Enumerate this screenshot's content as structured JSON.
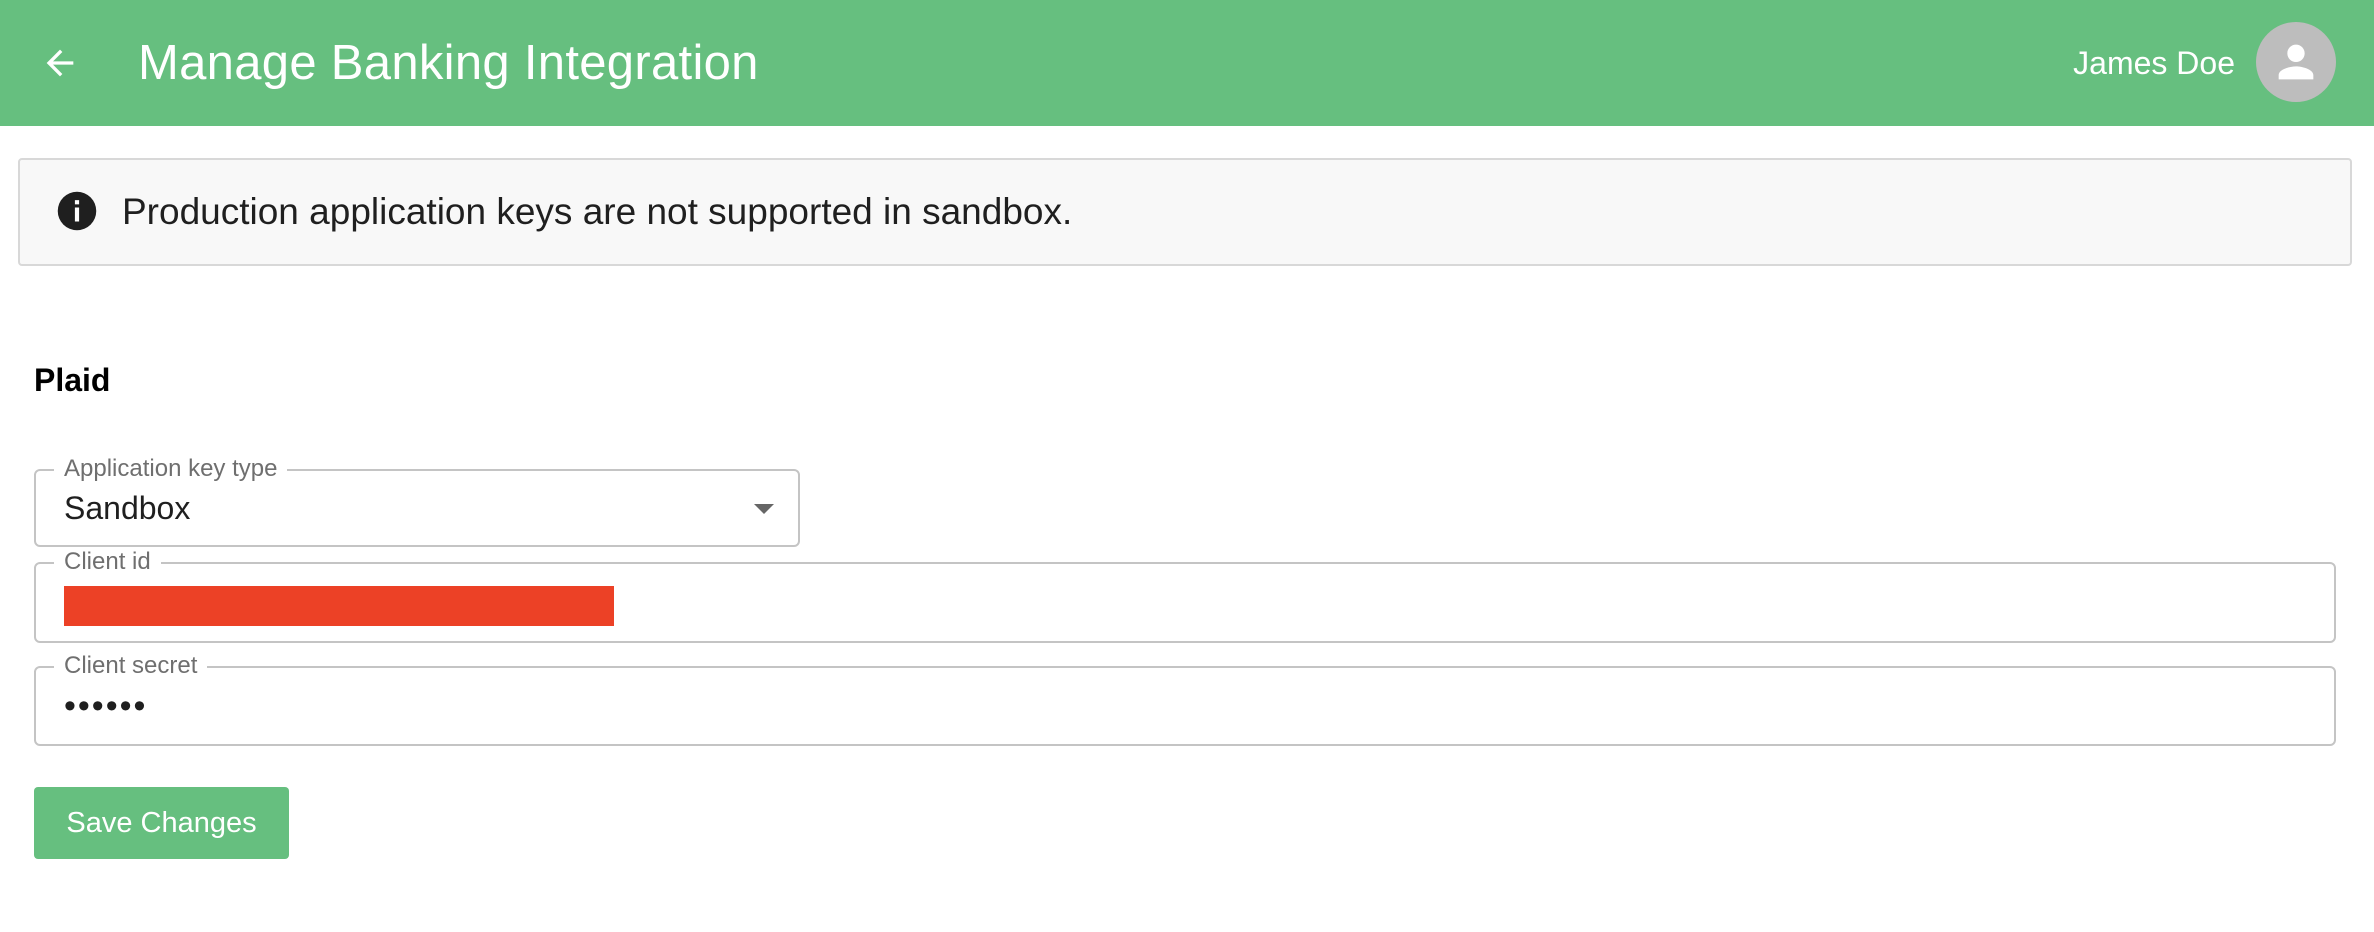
{
  "header": {
    "title": "Manage Banking Integration",
    "back_icon": "arrow-left-icon",
    "user_name": "James Doe",
    "avatar_icon": "person-icon",
    "background_color": "#66bf7f"
  },
  "alert": {
    "icon": "info-icon",
    "message": "Production application keys are not supported in sandbox."
  },
  "section": {
    "title": "Plaid"
  },
  "form": {
    "key_type": {
      "label": "Application key type",
      "value": "Sandbox"
    },
    "client_id": {
      "label": "Client id",
      "value_redacted": true,
      "redaction_color": "#ec4126"
    },
    "client_secret": {
      "label": "Client secret",
      "value": "••••••"
    }
  },
  "actions": {
    "save_label": "Save Changes"
  }
}
